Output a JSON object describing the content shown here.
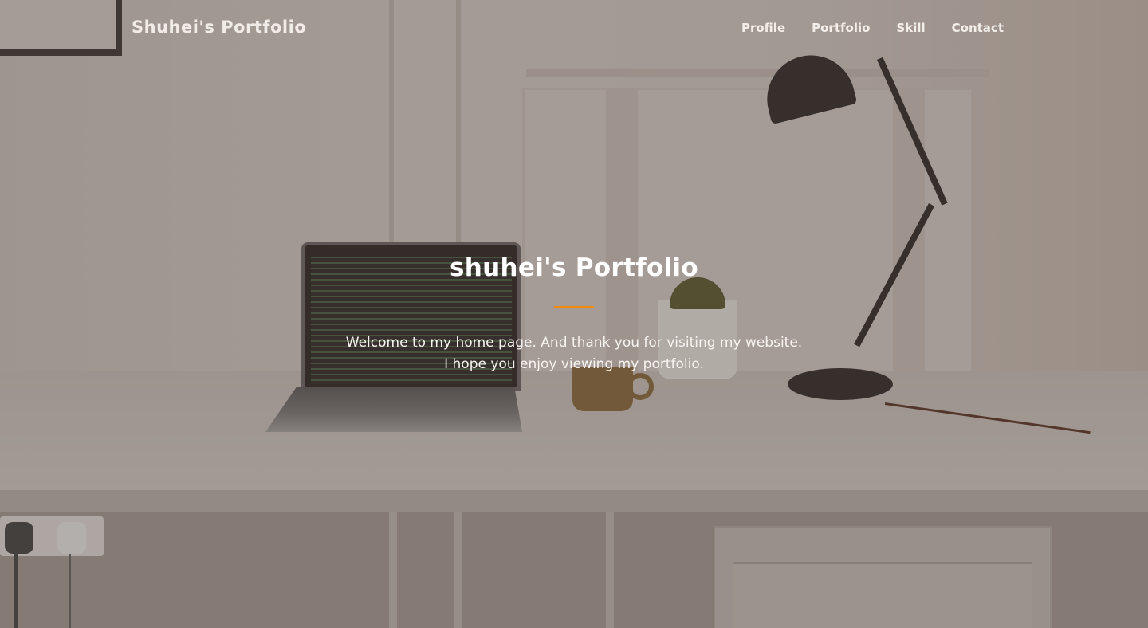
{
  "header": {
    "brand": "Shuhei's Portfolio",
    "nav": [
      {
        "label": "Profile"
      },
      {
        "label": "Portfolio"
      },
      {
        "label": "Skill"
      },
      {
        "label": "Contact"
      }
    ]
  },
  "hero": {
    "title": "shuhei's Portfolio",
    "line1": "Welcome to my home page. And thank you for visiting my website.",
    "line2": "I hope you enjoy viewing my portfolio."
  },
  "colors": {
    "accent": "#f28c0f",
    "text": "#ffffff"
  }
}
